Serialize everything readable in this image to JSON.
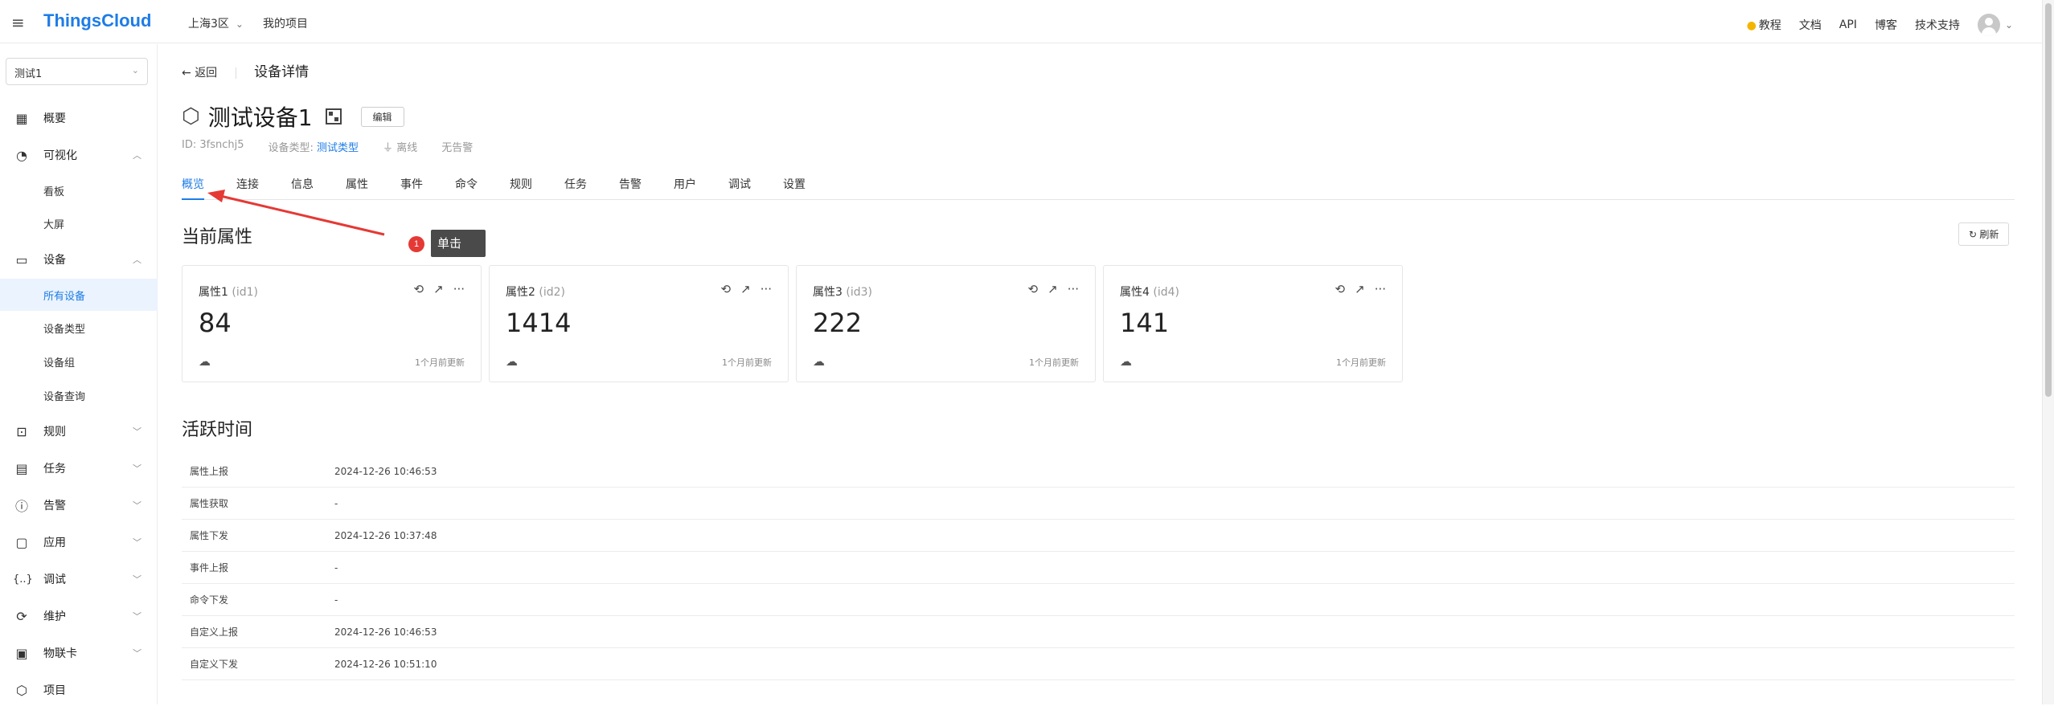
{
  "topbar": {
    "logo": "ThingsCloud",
    "region": "上海3区",
    "my_projects": "我的项目",
    "links": [
      "教程",
      "文档",
      "API",
      "博客",
      "技术支持"
    ]
  },
  "sidebar": {
    "project_select": "测试1",
    "items": [
      {
        "label": "概要",
        "icon": "dashboard-grid-icon"
      },
      {
        "label": "可视化",
        "icon": "gauge-icon"
      },
      {
        "label": "看板"
      },
      {
        "label": "大屏"
      },
      {
        "label": "设备",
        "icon": "devices-icon"
      },
      {
        "label": "所有设备"
      },
      {
        "label": "设备类型"
      },
      {
        "label": "设备组"
      },
      {
        "label": "设备查询"
      },
      {
        "label": "规则",
        "icon": "terminal-icon"
      },
      {
        "label": "任务",
        "icon": "calendar-clock-icon"
      },
      {
        "label": "告警",
        "icon": "alert-icon"
      },
      {
        "label": "应用",
        "icon": "window-icon"
      },
      {
        "label": "调试",
        "icon": "braces-icon"
      },
      {
        "label": "维护",
        "icon": "refresh-gear-icon"
      },
      {
        "label": "物联卡",
        "icon": "sim-card-icon"
      },
      {
        "label": "项目",
        "icon": "cube-icon"
      }
    ]
  },
  "header": {
    "back": "返回",
    "breadcrumb": "设备详情",
    "device_name": "测试设备1",
    "edit": "编辑",
    "id_text": "ID: 3fsnchj5",
    "type_label": "设备类型:",
    "type_value": "测试类型",
    "status": "离线",
    "alarm": "无告警"
  },
  "tabs": [
    "概览",
    "连接",
    "信息",
    "属性",
    "事件",
    "命令",
    "规则",
    "任务",
    "告警",
    "用户",
    "调试",
    "设置"
  ],
  "current_props_title": "当前属性",
  "refresh": "刷新",
  "properties": [
    {
      "name": "属性1",
      "id": "(id1)",
      "value": "84",
      "updated": "1个月前更新"
    },
    {
      "name": "属性2",
      "id": "(id2)",
      "value": "1414",
      "updated": "1个月前更新"
    },
    {
      "name": "属性3",
      "id": "(id3)",
      "value": "222",
      "updated": "1个月前更新"
    },
    {
      "name": "属性4",
      "id": "(id4)",
      "value": "141",
      "updated": "1个月前更新"
    }
  ],
  "active_title": "活跃时间",
  "activity": [
    {
      "k": "属性上报",
      "v": "2024-12-26 10:46:53"
    },
    {
      "k": "属性获取",
      "v": "-"
    },
    {
      "k": "属性下发",
      "v": "2024-12-26 10:37:48"
    },
    {
      "k": "事件上报",
      "v": "-"
    },
    {
      "k": "命令下发",
      "v": "-"
    },
    {
      "k": "自定义上报",
      "v": "2024-12-26 10:46:53"
    },
    {
      "k": "自定义下发",
      "v": "2024-12-26 10:51:10"
    }
  ],
  "annotation": {
    "number": "1",
    "text": "单击"
  }
}
